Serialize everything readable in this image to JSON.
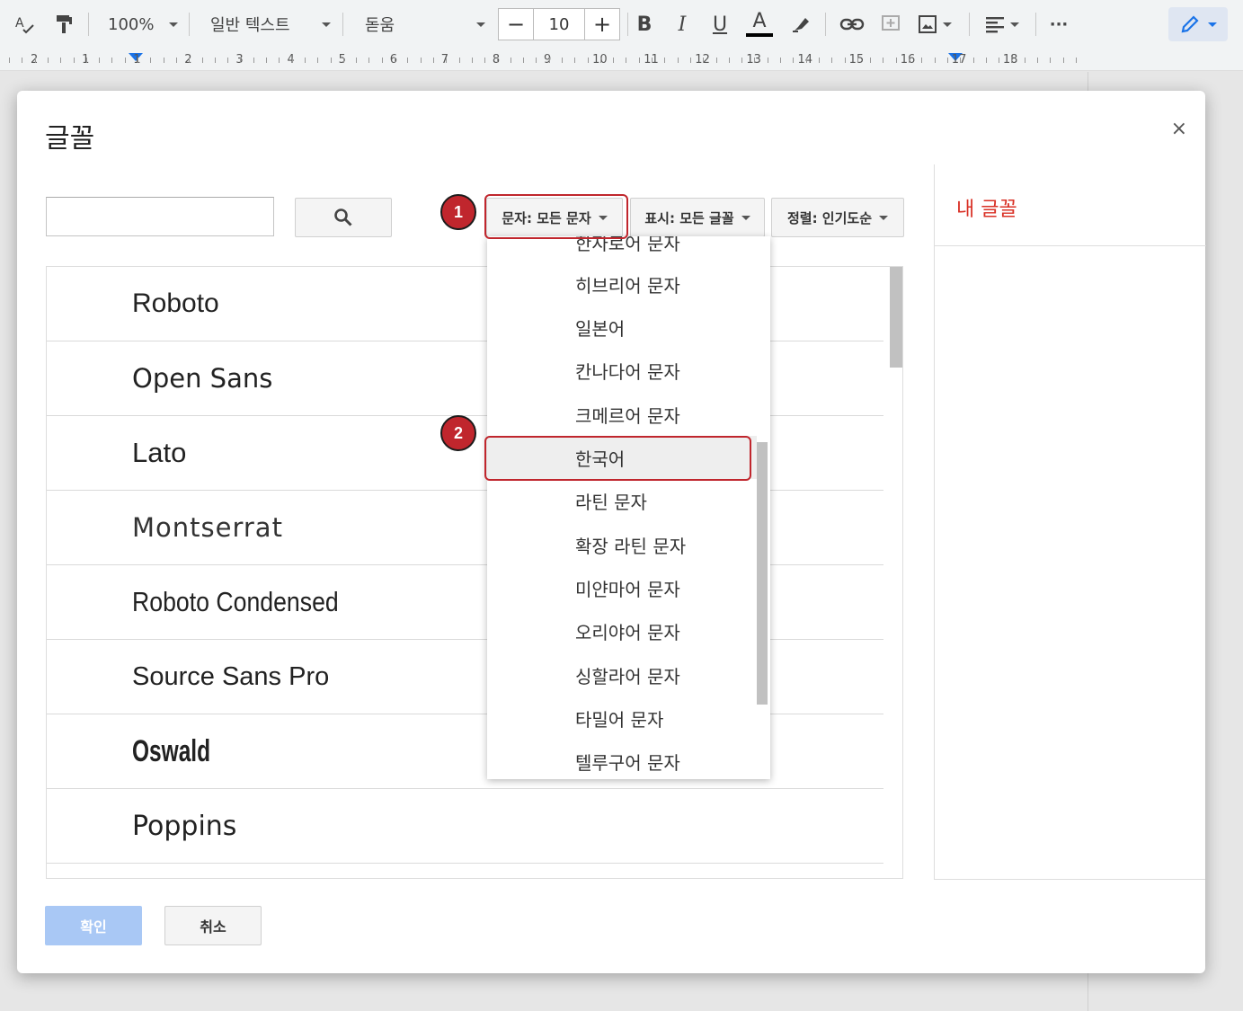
{
  "toolbar": {
    "zoom": "100%",
    "style": "일반 텍스트",
    "font": "돋움",
    "font_size": "10",
    "minus": "−",
    "plus": "+",
    "bold": "B",
    "italic": "I",
    "underline": "U",
    "text_color": "A",
    "more": "···"
  },
  "ruler": {
    "numbers": [
      "2",
      "1",
      "1",
      "2",
      "3",
      "4",
      "5",
      "6",
      "7",
      "8",
      "9",
      "10",
      "11",
      "12",
      "13",
      "14",
      "15",
      "16",
      "17",
      "18"
    ]
  },
  "dialog": {
    "title": "글꼴",
    "close": "×",
    "filters": {
      "script": "문자: 모든 문자",
      "show": "표시: 모든 글꼴",
      "sort": "정렬: 인기도순"
    },
    "fonts": [
      {
        "name": "Roboto"
      },
      {
        "name": "Open Sans"
      },
      {
        "name": "Lato"
      },
      {
        "name": "Montserrat"
      },
      {
        "name": "Roboto Condensed"
      },
      {
        "name": "Source Sans Pro"
      },
      {
        "name": "Oswald"
      },
      {
        "name": "Poppins"
      }
    ],
    "my_fonts_title": "내 글꼴",
    "ok": "확인",
    "cancel": "취소"
  },
  "dropdown": {
    "items": [
      "한자로어 문자",
      "히브리어 문자",
      "일본어",
      "칸나다어 문자",
      "크메르어 문자",
      "한국어",
      "라틴 문자",
      "확장 라틴 문자",
      "미얀마어 문자",
      "오리야어 문자",
      "싱할라어 문자",
      "타밀어 문자",
      "텔루구어 문자"
    ],
    "selected": "한국어"
  },
  "annotations": {
    "step1": "1",
    "step2": "2",
    "highlight_color": "#c0262d"
  },
  "colors": {
    "accent": "#1a73e8",
    "my_fonts_title": "#d93025",
    "ok_disabled": "#a9c8f5"
  }
}
